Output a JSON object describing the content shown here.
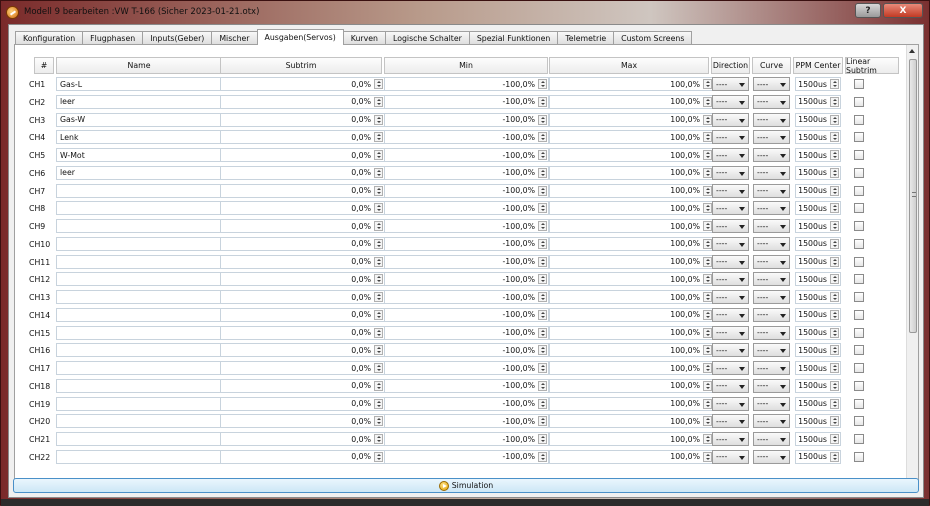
{
  "window": {
    "title": "Modell 9 bearbeiten :VW T-166   (Sicher 2023-01-21.otx)",
    "help_label": "?",
    "close_label": "X"
  },
  "tabs": [
    {
      "label": "Konfiguration",
      "active": false
    },
    {
      "label": "Flugphasen",
      "active": false
    },
    {
      "label": "Inputs(Geber)",
      "active": false
    },
    {
      "label": "Mischer",
      "active": false
    },
    {
      "label": "Ausgaben(Servos)",
      "active": true
    },
    {
      "label": "Kurven",
      "active": false
    },
    {
      "label": "Logische Schalter",
      "active": false
    },
    {
      "label": "Spezial Funktionen",
      "active": false
    },
    {
      "label": "Telemetrie",
      "active": false
    },
    {
      "label": "Custom Screens",
      "active": false
    }
  ],
  "table": {
    "headers": {
      "num": "#",
      "name": "Name",
      "subtrim": "Subtrim",
      "min": "Min",
      "max": "Max",
      "direction": "Direction",
      "curve": "Curve",
      "ppm_center": "PPM Center",
      "linear_subtrim": "Linear Subtrim"
    },
    "rows": [
      {
        "ch": "CH1",
        "name": "Gas-L",
        "subtrim": "0,0%",
        "min": "-100,0%",
        "max": "100,0%",
        "direction": "----",
        "curve": "----",
        "ppm": "1500us",
        "linear": false
      },
      {
        "ch": "CH2",
        "name": "leer",
        "subtrim": "0,0%",
        "min": "-100,0%",
        "max": "100,0%",
        "direction": "----",
        "curve": "----",
        "ppm": "1500us",
        "linear": false
      },
      {
        "ch": "CH3",
        "name": "Gas-W",
        "subtrim": "0,0%",
        "min": "-100,0%",
        "max": "100,0%",
        "direction": "----",
        "curve": "----",
        "ppm": "1500us",
        "linear": false
      },
      {
        "ch": "CH4",
        "name": "Lenk",
        "subtrim": "0,0%",
        "min": "-100,0%",
        "max": "100,0%",
        "direction": "----",
        "curve": "----",
        "ppm": "1500us",
        "linear": false
      },
      {
        "ch": "CH5",
        "name": "W-Mot",
        "subtrim": "0,0%",
        "min": "-100,0%",
        "max": "100,0%",
        "direction": "----",
        "curve": "----",
        "ppm": "1500us",
        "linear": false
      },
      {
        "ch": "CH6",
        "name": "leer",
        "subtrim": "0,0%",
        "min": "-100,0%",
        "max": "100,0%",
        "direction": "----",
        "curve": "----",
        "ppm": "1500us",
        "linear": false
      },
      {
        "ch": "CH7",
        "name": "",
        "subtrim": "0,0%",
        "min": "-100,0%",
        "max": "100,0%",
        "direction": "----",
        "curve": "----",
        "ppm": "1500us",
        "linear": false
      },
      {
        "ch": "CH8",
        "name": "",
        "subtrim": "0,0%",
        "min": "-100,0%",
        "max": "100,0%",
        "direction": "----",
        "curve": "----",
        "ppm": "1500us",
        "linear": false
      },
      {
        "ch": "CH9",
        "name": "",
        "subtrim": "0,0%",
        "min": "-100,0%",
        "max": "100,0%",
        "direction": "----",
        "curve": "----",
        "ppm": "1500us",
        "linear": false
      },
      {
        "ch": "CH10",
        "name": "",
        "subtrim": "0,0%",
        "min": "-100,0%",
        "max": "100,0%",
        "direction": "----",
        "curve": "----",
        "ppm": "1500us",
        "linear": false
      },
      {
        "ch": "CH11",
        "name": "",
        "subtrim": "0,0%",
        "min": "-100,0%",
        "max": "100,0%",
        "direction": "----",
        "curve": "----",
        "ppm": "1500us",
        "linear": false
      },
      {
        "ch": "CH12",
        "name": "",
        "subtrim": "0,0%",
        "min": "-100,0%",
        "max": "100,0%",
        "direction": "----",
        "curve": "----",
        "ppm": "1500us",
        "linear": false
      },
      {
        "ch": "CH13",
        "name": "",
        "subtrim": "0,0%",
        "min": "-100,0%",
        "max": "100,0%",
        "direction": "----",
        "curve": "----",
        "ppm": "1500us",
        "linear": false
      },
      {
        "ch": "CH14",
        "name": "",
        "subtrim": "0,0%",
        "min": "-100,0%",
        "max": "100,0%",
        "direction": "----",
        "curve": "----",
        "ppm": "1500us",
        "linear": false
      },
      {
        "ch": "CH15",
        "name": "",
        "subtrim": "0,0%",
        "min": "-100,0%",
        "max": "100,0%",
        "direction": "----",
        "curve": "----",
        "ppm": "1500us",
        "linear": false
      },
      {
        "ch": "CH16",
        "name": "",
        "subtrim": "0,0%",
        "min": "-100,0%",
        "max": "100,0%",
        "direction": "----",
        "curve": "----",
        "ppm": "1500us",
        "linear": false
      },
      {
        "ch": "CH17",
        "name": "",
        "subtrim": "0,0%",
        "min": "-100,0%",
        "max": "100,0%",
        "direction": "----",
        "curve": "----",
        "ppm": "1500us",
        "linear": false
      },
      {
        "ch": "CH18",
        "name": "",
        "subtrim": "0,0%",
        "min": "-100,0%",
        "max": "100,0%",
        "direction": "----",
        "curve": "----",
        "ppm": "1500us",
        "linear": false
      },
      {
        "ch": "CH19",
        "name": "",
        "subtrim": "0,0%",
        "min": "-100,0%",
        "max": "100,0%",
        "direction": "----",
        "curve": "----",
        "ppm": "1500us",
        "linear": false
      },
      {
        "ch": "CH20",
        "name": "",
        "subtrim": "0,0%",
        "min": "-100,0%",
        "max": "100,0%",
        "direction": "----",
        "curve": "----",
        "ppm": "1500us",
        "linear": false
      },
      {
        "ch": "CH21",
        "name": "",
        "subtrim": "0,0%",
        "min": "-100,0%",
        "max": "100,0%",
        "direction": "----",
        "curve": "----",
        "ppm": "1500us",
        "linear": false
      },
      {
        "ch": "CH22",
        "name": "",
        "subtrim": "0,0%",
        "min": "-100,0%",
        "max": "100,0%",
        "direction": "----",
        "curve": "----",
        "ppm": "1500us",
        "linear": false
      }
    ]
  },
  "simulation_label": "Simulation"
}
